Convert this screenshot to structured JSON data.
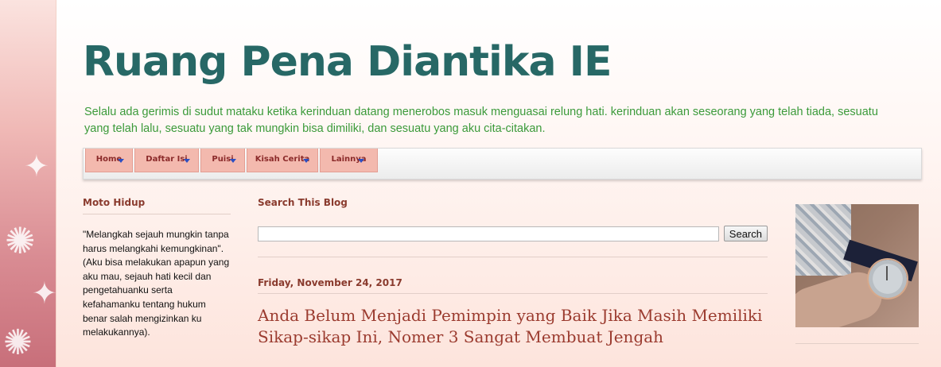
{
  "header": {
    "title": "Ruang Pena Diantika IE",
    "description": "Selalu ada gerimis di sudut mataku ketika kerinduan datang menerobos masuk menguasai relung hati. kerinduan akan seseorang yang telah tiada, sesuatu yang telah lalu, sesuatu yang tak mungkin bisa dimiliki, dan sesuatu yang aku cita-citakan."
  },
  "menu": {
    "items": [
      {
        "label": "Home"
      },
      {
        "label": "Daftar Isi"
      },
      {
        "label": "Puisi"
      },
      {
        "label": "Kisah Cerita"
      },
      {
        "label": "Lainnya"
      }
    ]
  },
  "sidebar_left": {
    "title": "Moto Hidup",
    "text": "\"Melangkah sejauh mungkin tanpa harus melangkahi kemungkinan\". (Aku bisa melakukan apapun yang aku mau, sejauh hati kecil dan pengetahuanku serta kefahamanku tentang hukum benar salah mengizinkan ku melakukannya)."
  },
  "search": {
    "title": "Search This Blog",
    "placeholder": "",
    "button_label": "Search"
  },
  "post": {
    "date": "Friday, November 24, 2017",
    "title": "Anda Belum Menjadi Pemimpin yang Baik Jika Masih Memiliki Sikap-sikap Ini, Nomer 3 Sangat Membuat Jengah"
  },
  "colors": {
    "title": "#276866",
    "description": "#3b9a3a",
    "menu_item_bg": "#f3b9ae",
    "heading": "#8a3b2e",
    "post_title": "#9b3b2f"
  }
}
